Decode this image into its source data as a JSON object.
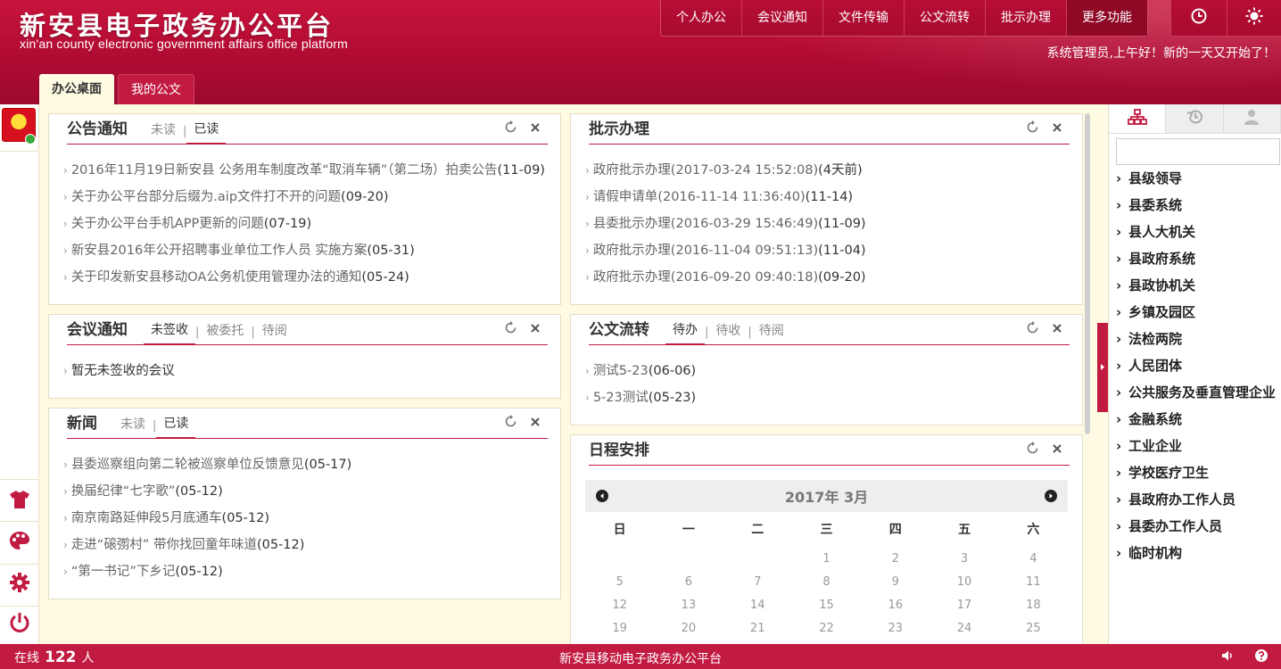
{
  "brand": {
    "title": "新安县电子政务办公平台",
    "subtitle": "xin'an county electronic government affairs office platform"
  },
  "topnav": [
    {
      "label": "个人办公"
    },
    {
      "label": "会议通知"
    },
    {
      "label": "文件传输"
    },
    {
      "label": "公文流转"
    },
    {
      "label": "批示办理"
    },
    {
      "label": "更多功能"
    }
  ],
  "topicons": [
    "clock-icon",
    "sun-icon"
  ],
  "greeting": "系统管理员,上午好！新的一天又开始了！",
  "tabs": [
    {
      "label": "办公桌面",
      "active": true
    },
    {
      "label": "我的公文",
      "active": false
    }
  ],
  "panels": {
    "notice": {
      "title": "公告通知",
      "tabs": [
        "未读",
        "已读"
      ],
      "active_tab": "已读",
      "items": [
        {
          "text": "2016年11月19日新安县 公务用车制度改革“取消车辆”（第二场）拍卖公告",
          "date": "(11-09)"
        },
        {
          "text": "关于办公平台部分后缀为.aip文件打不开的问题",
          "date": "(09-20)"
        },
        {
          "text": "关于办公平台手机APP更新的问题",
          "date": "(07-19)"
        },
        {
          "text": "新安县2016年公开招聘事业单位工作人员 实施方案",
          "date": "(05-31)"
        },
        {
          "text": "关于印发新安县移动OA公务机使用管理办法的通知",
          "date": "(05-24)"
        }
      ]
    },
    "approval": {
      "title": "批示办理",
      "items": [
        {
          "text": "政府批示办理(2017-03-24 15:52:08)",
          "date": "(4天前)"
        },
        {
          "text": "请假申请单(2016-11-14 11:36:40)",
          "date": "(11-14)"
        },
        {
          "text": "县委批示办理(2016-03-29 15:46:49)",
          "date": "(11-09)"
        },
        {
          "text": "政府批示办理(2016-11-04 09:51:13)",
          "date": "(11-04)"
        },
        {
          "text": "政府批示办理(2016-09-20 09:40:18)",
          "date": "(09-20)"
        }
      ]
    },
    "meeting": {
      "title": "会议通知",
      "tabs": [
        "未签收",
        "被委托",
        "待阅"
      ],
      "active_tab": "未签收",
      "items": [
        {
          "text": "暂无未签收的会议",
          "date": ""
        }
      ]
    },
    "docflow": {
      "title": "公文流转",
      "tabs": [
        "待办",
        "待收",
        "待阅"
      ],
      "active_tab": "待办",
      "items": [
        {
          "text": "测试5-23",
          "date": "(06-06)"
        },
        {
          "text": "5-23测试",
          "date": "(05-23)"
        }
      ]
    },
    "news": {
      "title": "新闻",
      "tabs": [
        "未读",
        "已读"
      ],
      "active_tab": "已读",
      "items": [
        {
          "text": "县委巡察组向第二轮被巡察单位反馈意见",
          "date": "(05-17)"
        },
        {
          "text": "换届纪律“七字歌”",
          "date": "(05-12)"
        },
        {
          "text": "南京南路延伸段5月底通车",
          "date": "(05-12)"
        },
        {
          "text": "走进“磙彅村” 带你找回童年味道",
          "date": "(05-12)"
        },
        {
          "text": "“第一书记”下乡记",
          "date": "(05-12)"
        }
      ]
    },
    "schedule": {
      "title": "日程安排",
      "month_label": "2017年 3月",
      "weekdays": [
        "日",
        "一",
        "二",
        "三",
        "四",
        "五",
        "六"
      ],
      "days": [
        "",
        "",
        "",
        "1",
        "2",
        "3",
        "4",
        "5",
        "6",
        "7",
        "8",
        "9",
        "10",
        "11",
        "12",
        "13",
        "14",
        "15",
        "16",
        "17",
        "18",
        "19",
        "20",
        "21",
        "22",
        "23",
        "24",
        "25"
      ]
    }
  },
  "rightpanel": {
    "tab_icons": [
      "org-tree-icon",
      "history-icon",
      "contact-icon"
    ],
    "search_placeholder": "",
    "items": [
      "县级领导",
      "县委系统",
      "县人大机关",
      "县政府系统",
      "县政协机关",
      "乡镇及园区",
      "法检两院",
      "人民团体",
      "公共服务及垂直管理企业",
      "金融系统",
      "工业企业",
      "学校医疗卫生",
      "县政府办工作人员",
      "县委办工作人员",
      "临时机构"
    ]
  },
  "footer": {
    "online_prefix": "在线",
    "online_count": "122",
    "online_suffix": "人",
    "center_text": "新安县移动电子政务办公平台"
  },
  "colors": {
    "brand": "#c21b42",
    "header_dark": "#9c0a2d",
    "page_bg": "#fffbe3"
  }
}
